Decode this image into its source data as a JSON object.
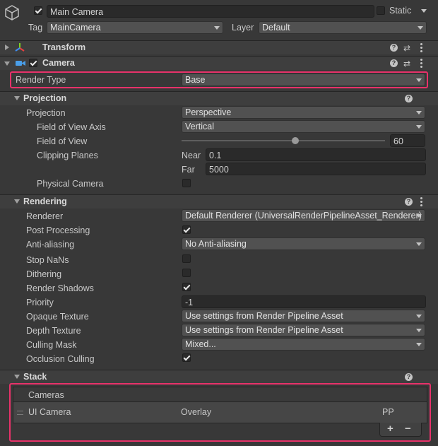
{
  "header": {
    "object_name": "Main Camera",
    "static_label": "Static",
    "tag_label": "Tag",
    "tag_value": "MainCamera",
    "layer_label": "Layer",
    "layer_value": "Default"
  },
  "components": {
    "transform": "Transform",
    "camera": "Camera"
  },
  "render_type": {
    "label": "Render Type",
    "value": "Base"
  },
  "projection": {
    "section": "Projection",
    "projection_label": "Projection",
    "projection_value": "Perspective",
    "fov_axis_label": "Field of View Axis",
    "fov_axis_value": "Vertical",
    "fov_label": "Field of View",
    "fov_value": "60",
    "fov_fraction": 0.56,
    "clipping_label": "Clipping Planes",
    "near_label": "Near",
    "near_value": "0.1",
    "far_label": "Far",
    "far_value": "5000",
    "physical_label": "Physical Camera"
  },
  "rendering": {
    "section": "Rendering",
    "renderer_label": "Renderer",
    "renderer_value": "Default Renderer (UniversalRenderPipelineAsset_Renderer)",
    "post_label": "Post Processing",
    "aa_label": "Anti-aliasing",
    "aa_value": "No Anti-aliasing",
    "stopnans_label": "Stop NaNs",
    "dither_label": "Dithering",
    "shadows_label": "Render Shadows",
    "priority_label": "Priority",
    "priority_value": "-1",
    "opaque_label": "Opaque Texture",
    "opaque_value": "Use settings from Render Pipeline Asset",
    "depth_label": "Depth Texture",
    "depth_value": "Use settings from Render Pipeline Asset",
    "culling_label": "Culling Mask",
    "culling_value": "Mixed...",
    "occlusion_label": "Occlusion Culling"
  },
  "stack": {
    "section": "Stack",
    "list_header": "Cameras",
    "rows": [
      {
        "name": "UI Camera",
        "type": "Overlay",
        "tag": "PP"
      }
    ],
    "add": "+",
    "remove": "−"
  },
  "colors": {
    "highlight": "#e8326a",
    "background": "#383838"
  }
}
